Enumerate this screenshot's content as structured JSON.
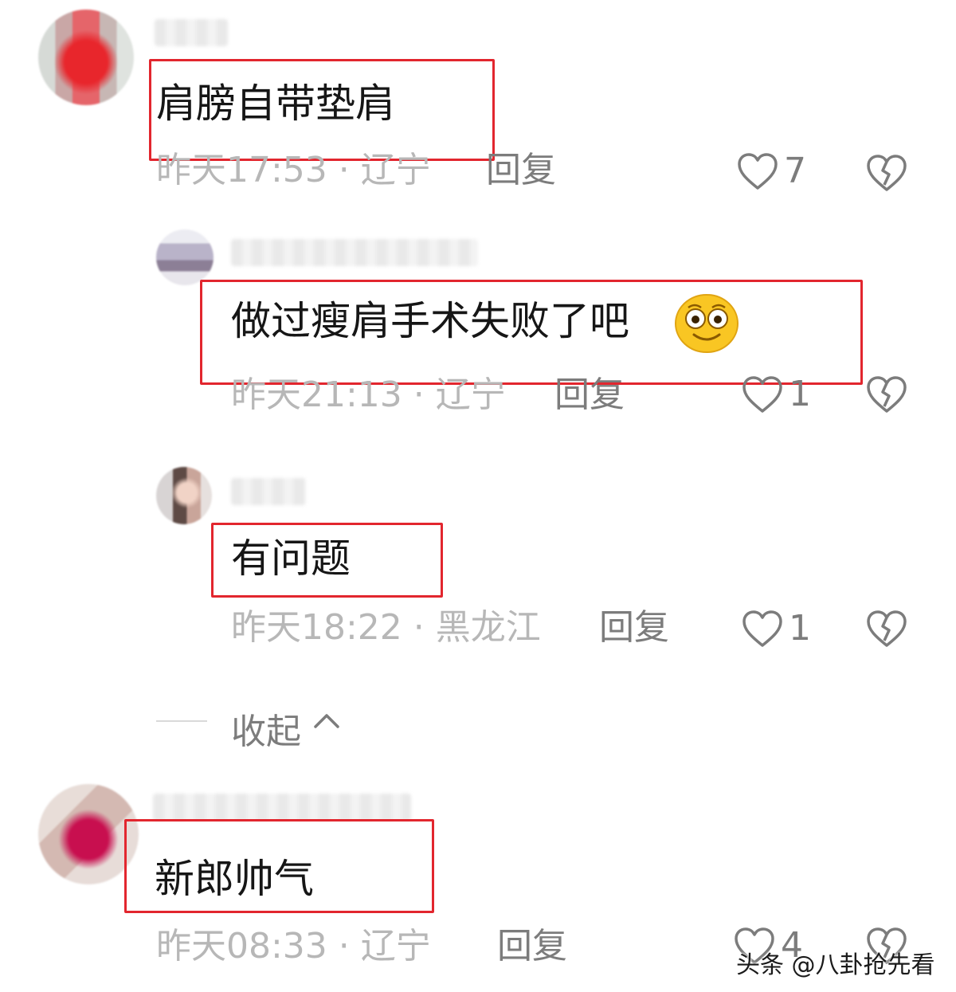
{
  "comments": [
    {
      "text": "肩膀自带垫肩",
      "meta": "昨天17:53 · 辽宁",
      "reply_label": "回复",
      "likes": "7"
    },
    {
      "text": "做过瘦肩手术失败了吧",
      "emoji": "😳",
      "meta": "昨天21:13 · 辽宁",
      "reply_label": "回复",
      "likes": "1"
    },
    {
      "text": "有问题",
      "meta": "昨天18:22 · 黑龙江",
      "reply_label": "回复",
      "likes": "1"
    },
    {
      "text": "新郎帅气",
      "meta": "昨天08:33 · 辽宁",
      "reply_label": "回复",
      "likes": "4"
    }
  ],
  "collapse_label": "收起",
  "watermark": "头条 @八卦抢先看",
  "colors": {
    "highlight_box": "#e2262e",
    "meta_text": "#b7b7b7",
    "action_text": "#7c7c7c"
  },
  "icons": [
    "heart-outline-icon",
    "broken-heart-icon",
    "chevron-up-icon"
  ]
}
